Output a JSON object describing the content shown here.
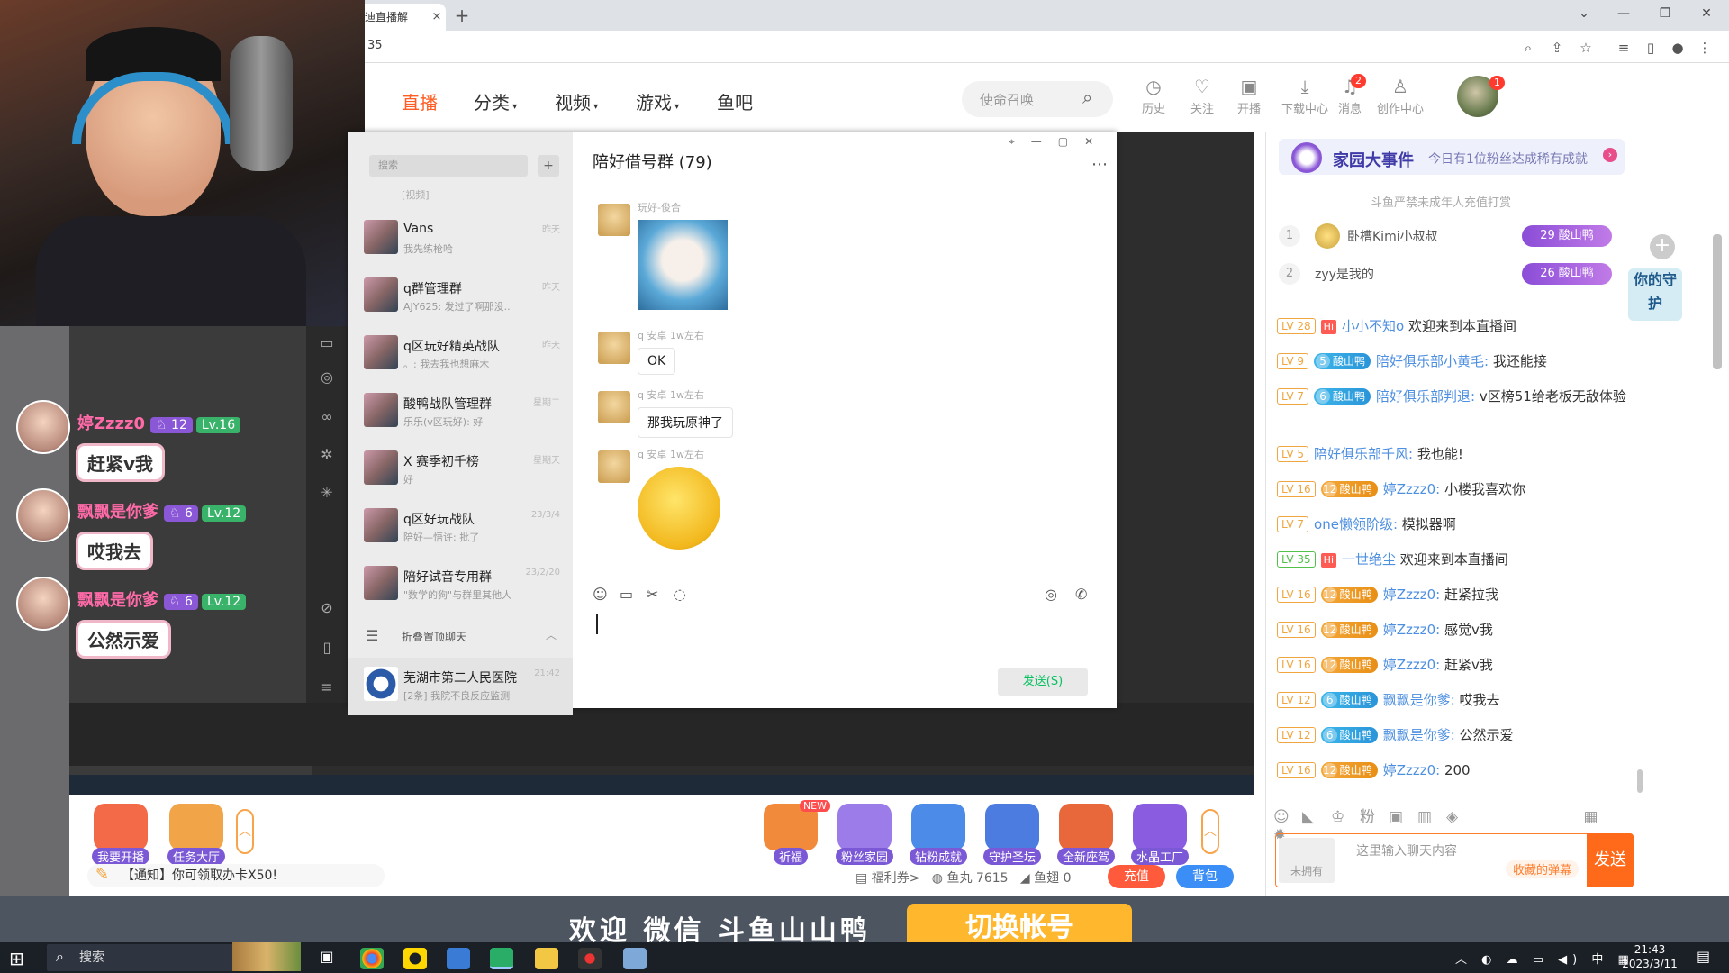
{
  "browser": {
    "tab_title": "迪直播解",
    "tab_close": "×",
    "new_tab": "+",
    "address": "35",
    "window_controls": [
      "⌄",
      "—",
      "❐",
      "✕"
    ]
  },
  "site": {
    "nav": [
      "直播",
      "分类",
      "视频",
      "游戏",
      "鱼吧"
    ],
    "search_placeholder": "使命召唤",
    "header_items": [
      {
        "label": "历史",
        "icon": "history-icon",
        "badge": ""
      },
      {
        "label": "关注",
        "icon": "heart-icon",
        "badge": ""
      },
      {
        "label": "开播",
        "icon": "broadcast-icon",
        "badge": ""
      },
      {
        "label": "下载中心",
        "icon": "download-icon",
        "badge": ""
      },
      {
        "label": "消息",
        "icon": "bell-icon",
        "badge": "2"
      },
      {
        "label": "创作中心",
        "icon": "creator-icon",
        "badge": ""
      }
    ],
    "avatar_badge": "1"
  },
  "wechat": {
    "search_placeholder": "搜索",
    "add": "+",
    "top_preview": "[视频]",
    "chats": [
      {
        "name": "Vans",
        "preview": "我先练枪哈",
        "time": "昨天"
      },
      {
        "name": "q群管理群",
        "preview": "AJY625: 发过了啊那没...",
        "time": "昨天"
      },
      {
        "name": "q区玩好精英战队",
        "preview": "。: 我去我也想麻木",
        "time": "昨天"
      },
      {
        "name": "酸鸭战队管理群",
        "preview": "乐乐(v区玩好): 好",
        "time": "星期二"
      },
      {
        "name": "X 赛季初千榜",
        "preview": "好",
        "time": "星期天"
      },
      {
        "name": "q区好玩战队",
        "preview": "陪好—悟许: 批了",
        "time": "23/3/4"
      },
      {
        "name": "陪好试音专用群",
        "preview": "\"数学的狗\"与群里其他人...",
        "time": "23/2/20"
      }
    ],
    "folded_label": "折叠置顶聊天",
    "hospital": {
      "name": "芜湖市第二人民医院",
      "preview": "[2条] 我院不良反应监测...",
      "time": "21:42"
    },
    "chat_title": "陪好借号群 (79)",
    "messages": [
      {
        "sender": "玩好-俊合",
        "text": ""
      },
      {
        "sender": "q 安卓 1w左右",
        "text": "OK"
      },
      {
        "sender": "q 安卓 1w左右",
        "text": "那我玩原神了"
      },
      {
        "sender": "q 安卓 1w左右",
        "text": ""
      }
    ],
    "send_label": "发送(S)"
  },
  "danmu": [
    {
      "name": "婷Zzzz0",
      "fan_level": "12",
      "level": "Lv.16",
      "text": "赶紧v我"
    },
    {
      "name": "飘飘是你爹",
      "fan_level": "6",
      "level": "Lv.12",
      "text": "哎我去"
    },
    {
      "name": "飘飘是你爹",
      "fan_level": "6",
      "level": "Lv.12",
      "text": "公然示爱"
    }
  ],
  "gifts_left": [
    {
      "label": "我要开播",
      "color": "#f36a48"
    },
    {
      "label": "任务大厅",
      "color": "#f2a548"
    }
  ],
  "gifts_right": [
    {
      "label": "祈福",
      "color": "#f28a3b",
      "new": "NEW"
    },
    {
      "label": "粉丝家园",
      "color": "#9c7ce8",
      "new": ""
    },
    {
      "label": "钻粉成就",
      "color": "#4c8ce8",
      "new": ""
    },
    {
      "label": "守护圣坛",
      "color": "#4c7ce0",
      "new": ""
    },
    {
      "label": "全新座驾",
      "color": "#e8683b",
      "new": ""
    },
    {
      "label": "水晶工厂",
      "color": "#8a5de0",
      "new": ""
    }
  ],
  "notice": "【通知】你可领取办卡X50!",
  "wallet": {
    "coupon_label": "福利券",
    "coupon_arrow": ">",
    "fishball_label": "鱼丸",
    "fishball": "7615",
    "fishfin_label": "鱼翅",
    "fishfin": "0",
    "recharge": "充值",
    "bag": "背包"
  },
  "bottom_text": "欢迎 微信 斗鱼山山鸭",
  "switch_account": "切换帐号",
  "right": {
    "event_title": "家园大事件",
    "event_text": "今日有1位粉丝达成稀有成就",
    "minor_warning": "斗鱼严禁未成年人充值打赏",
    "ranks": [
      {
        "rank": "1",
        "name": "卧槽Kimi小叔叔",
        "badge": "酸山鸭",
        "badge_level": "29"
      },
      {
        "rank": "2",
        "name": "zyy是我的",
        "badge": "酸山鸭",
        "badge_level": "26"
      }
    ],
    "messages": [
      {
        "lv": "LV 28",
        "fan": "",
        "fan_level": "",
        "hi": "Hi",
        "user": "小小不知o",
        "text": "欢迎来到本直播间"
      },
      {
        "lv": "LV 9",
        "fan": "酸山鸭",
        "fan_level": "5",
        "hi": "",
        "user": "陪好俱乐部小黄毛:",
        "text": "我还能接"
      },
      {
        "lv": "LV 7",
        "fan": "酸山鸭",
        "fan_level": "6",
        "hi": "",
        "user": "陪好俱乐部判退:",
        "text": "v区榜51给老板无敌体验"
      },
      {
        "lv": "LV 5",
        "fan": "",
        "fan_level": "",
        "hi": "",
        "user": "陪好俱乐部千风:",
        "text": "我也能!"
      },
      {
        "lv": "LV 16",
        "fan": "酸山鸭",
        "fan_level": "12",
        "hi": "",
        "user": "婷Zzzz0:",
        "text": "小楼我喜欢你"
      },
      {
        "lv": "LV 7",
        "fan": "",
        "fan_level": "",
        "hi": "",
        "user": "one懒领阶级:",
        "text": "模拟器啊"
      },
      {
        "lv": "LV 35",
        "fan": "",
        "fan_level": "",
        "hi": "Hi",
        "user": "一世绝尘",
        "text": "欢迎来到本直播间"
      },
      {
        "lv": "LV 16",
        "fan": "酸山鸭",
        "fan_level": "12",
        "hi": "",
        "user": "婷Zzzz0:",
        "text": "赶紧拉我"
      },
      {
        "lv": "LV 16",
        "fan": "酸山鸭",
        "fan_level": "12",
        "hi": "",
        "user": "婷Zzzz0:",
        "text": "感觉v我"
      },
      {
        "lv": "LV 16",
        "fan": "酸山鸭",
        "fan_level": "12",
        "hi": "",
        "user": "婷Zzzz0:",
        "text": "赶紧v我"
      },
      {
        "lv": "LV 12",
        "fan": "酸山鸭",
        "fan_level": "6",
        "hi": "",
        "user": "飘飘是你爹:",
        "text": "哎我去"
      },
      {
        "lv": "LV 12",
        "fan": "酸山鸭",
        "fan_level": "6",
        "hi": "",
        "user": "飘飘是你爹:",
        "text": "公然示爱"
      },
      {
        "lv": "LV 16",
        "fan": "酸山鸭",
        "fan_level": "12",
        "hi": "",
        "user": "婷Zzzz0:",
        "text": "200"
      }
    ],
    "input_placeholder": "这里输入聊天内容",
    "collect": "收藏的弹幕",
    "not_owned": "未拥有",
    "send": "发送",
    "guard_label": "你的守护"
  },
  "os": {
    "search": "搜索",
    "time": "21:43",
    "date": "2023/3/11",
    "ime": "中"
  }
}
